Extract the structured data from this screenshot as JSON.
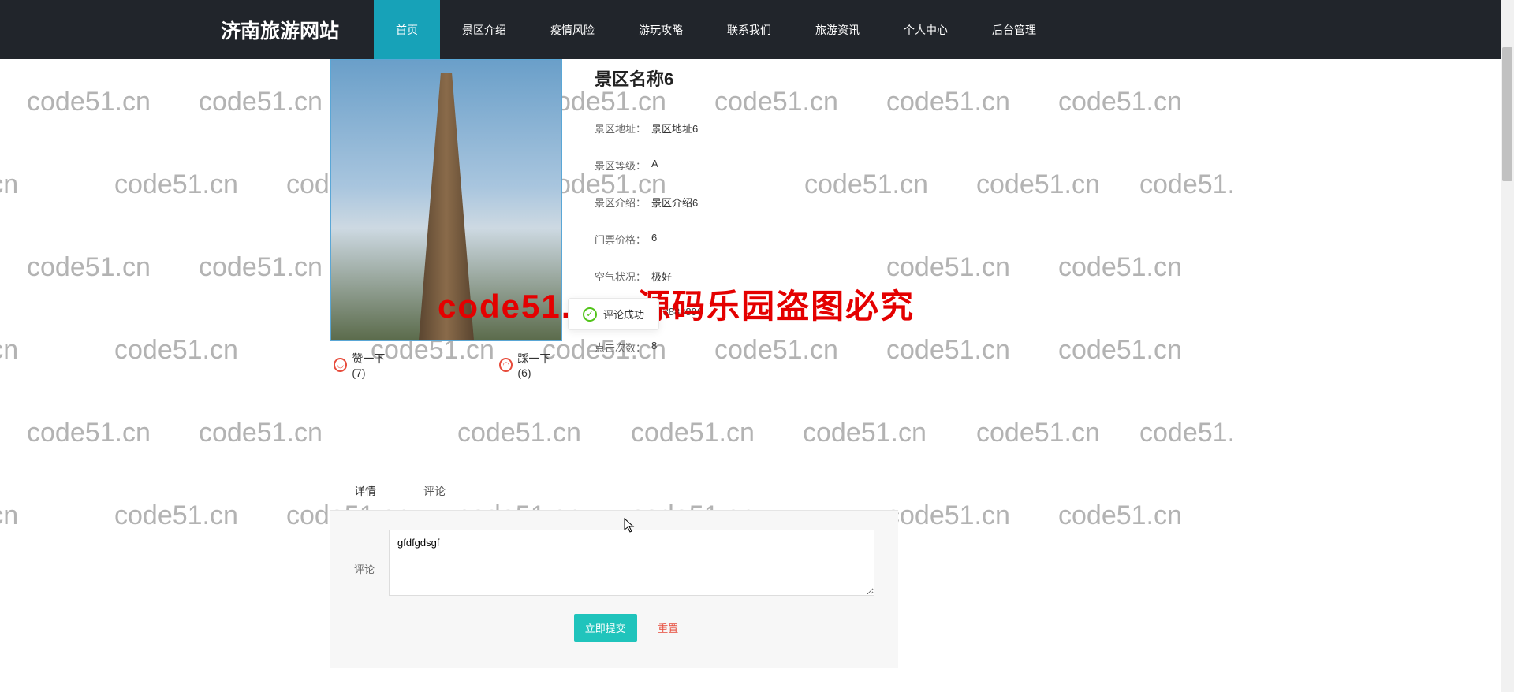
{
  "site": {
    "title": "济南旅游网站"
  },
  "nav": {
    "items": [
      {
        "label": "首页",
        "active": true
      },
      {
        "label": "景区介绍",
        "active": false
      },
      {
        "label": "疫情风险",
        "active": false
      },
      {
        "label": "游玩攻略",
        "active": false
      },
      {
        "label": "联系我们",
        "active": false
      },
      {
        "label": "旅游资讯",
        "active": false
      },
      {
        "label": "个人中心",
        "active": false
      },
      {
        "label": "后台管理",
        "active": false
      }
    ]
  },
  "detail": {
    "title": "景区名称6",
    "fields": [
      {
        "label": "景区地址：",
        "value": "景区地址6"
      },
      {
        "label": "景区等级：",
        "value": "A"
      },
      {
        "label": "景区介绍：",
        "value": "景区介绍6"
      },
      {
        "label": "门票价格：",
        "value": "6"
      },
      {
        "label": "空气状况：",
        "value": "极好"
      },
      {
        "label": "",
        "value": "323888886"
      },
      {
        "label": "点击次数：",
        "value": "8"
      }
    ],
    "like_label": "赞一下(7)",
    "dislike_label": "踩一下(6)"
  },
  "toast": {
    "message": "评论成功"
  },
  "tabs": {
    "detail": "详情",
    "comment": "评论"
  },
  "comment": {
    "label": "评论",
    "textarea_value": "gfdfgdsgf",
    "submit_label": "立即提交",
    "reset_label": "重置"
  },
  "watermark": {
    "text": "code51.cn",
    "big": "code51. cn-源码乐园盗图必究"
  }
}
